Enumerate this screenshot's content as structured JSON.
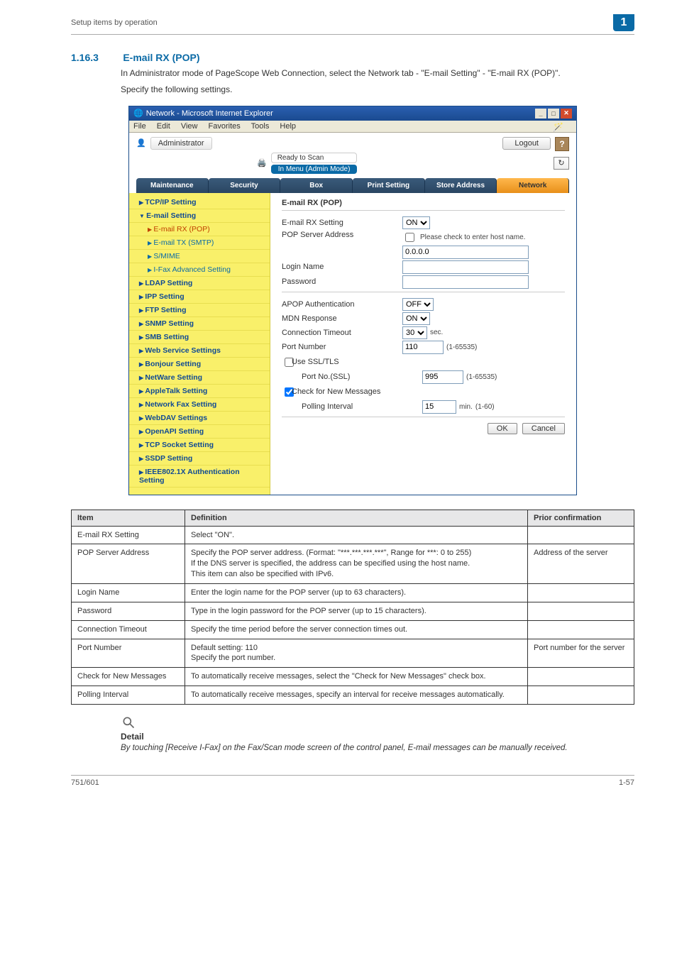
{
  "page": {
    "breadcrumb": "Setup items by operation",
    "chapter_badge": "1",
    "section_number": "1.16.3",
    "section_title": "E-mail RX (POP)",
    "intro_1": "In Administrator mode of PageScope Web Connection, select the Network tab - \"E-mail Setting\" - \"E-mail RX (POP)\".",
    "intro_2": "Specify the following settings.",
    "footer_left": "751/601",
    "footer_right": "1-57"
  },
  "browser": {
    "title": "Network - Microsoft Internet Explorer",
    "menu": {
      "file": "File",
      "edit": "Edit",
      "view": "View",
      "favorites": "Favorites",
      "tools": "Tools",
      "help": "Help"
    },
    "admin_icon_name": "user-icon",
    "admin_label": "Administrator",
    "logout": "Logout",
    "help_q": "?",
    "ready": "Ready to Scan",
    "mode": "In Menu (Admin Mode)",
    "refresh_glyph": "↻",
    "tabs": {
      "maintenance": "Maintenance",
      "security": "Security",
      "box": "Box",
      "print": "Print Setting",
      "store": "Store Address",
      "network": "Network"
    }
  },
  "sidebar": {
    "items": [
      {
        "label": "TCP/IP Setting",
        "type": "group",
        "arrow": "▶"
      },
      {
        "label": "E-mail Setting",
        "type": "group open",
        "arrow": "▼"
      },
      {
        "label": "E-mail RX (POP)",
        "type": "sub selected",
        "arrow": "▶"
      },
      {
        "label": "E-mail TX (SMTP)",
        "type": "sub",
        "arrow": "▶"
      },
      {
        "label": "S/MIME",
        "type": "sub",
        "arrow": "▶"
      },
      {
        "label": "I-Fax Advanced Setting",
        "type": "sub",
        "arrow": "▶"
      },
      {
        "label": "LDAP Setting",
        "type": "group",
        "arrow": "▶"
      },
      {
        "label": "IPP Setting",
        "type": "group",
        "arrow": "▶"
      },
      {
        "label": "FTP Setting",
        "type": "group",
        "arrow": "▶"
      },
      {
        "label": "SNMP Setting",
        "type": "group",
        "arrow": "▶"
      },
      {
        "label": "SMB Setting",
        "type": "group",
        "arrow": "▶"
      },
      {
        "label": "Web Service Settings",
        "type": "group",
        "arrow": "▶"
      },
      {
        "label": "Bonjour Setting",
        "type": "group",
        "arrow": "▶"
      },
      {
        "label": "NetWare Setting",
        "type": "group",
        "arrow": "▶"
      },
      {
        "label": "AppleTalk Setting",
        "type": "group",
        "arrow": "▶"
      },
      {
        "label": "Network Fax Setting",
        "type": "group",
        "arrow": "▶"
      },
      {
        "label": "WebDAV Settings",
        "type": "group",
        "arrow": "▶"
      },
      {
        "label": "OpenAPI Setting",
        "type": "group",
        "arrow": "▶"
      },
      {
        "label": "TCP Socket Setting",
        "type": "group",
        "arrow": "▶"
      },
      {
        "label": "SSDP Setting",
        "type": "group",
        "arrow": "▶"
      },
      {
        "label": "IEEE802.1X Authentication Setting",
        "type": "group",
        "arrow": "▶"
      }
    ]
  },
  "form": {
    "heading": "E-mail RX (POP)",
    "rows": {
      "rx_setting": {
        "label": "E-mail RX Setting",
        "value": "ON"
      },
      "pop_addr": {
        "label": "POP Server Address",
        "checkbox": "Please check to enter host name.",
        "value": "0.0.0.0"
      },
      "login": {
        "label": "Login Name",
        "value": ""
      },
      "pwd": {
        "label": "Password",
        "value": ""
      },
      "apop": {
        "label": "APOP Authentication",
        "value": "OFF"
      },
      "mdn": {
        "label": "MDN Response",
        "value": "ON"
      },
      "conn": {
        "label": "Connection Timeout",
        "value": "30",
        "unit": "sec."
      },
      "port": {
        "label": "Port Number",
        "value": "110",
        "hint": "(1-65535)"
      },
      "ssl": {
        "label": "Use SSL/TLS"
      },
      "sslport": {
        "label": "Port No.(SSL)",
        "value": "995",
        "hint": "(1-65535)"
      },
      "newmsg": {
        "label": "Check for New Messages"
      },
      "poll": {
        "label": "Polling Interval",
        "value": "15",
        "unit": "min.",
        "hint": "(1-60)"
      }
    },
    "ok": "OK",
    "cancel": "Cancel"
  },
  "table": {
    "head": {
      "item": "Item",
      "def": "Definition",
      "prior": "Prior confirmation"
    },
    "rows": [
      {
        "item": "E-mail RX Setting",
        "def": "Select \"ON\".",
        "prior": ""
      },
      {
        "item": "POP Server Address",
        "def": "Specify the POP server address. (Format: \"***.***.***.***\", Range for ***: 0 to 255)\nIf the DNS server is specified, the address can be specified using the host name.\nThis item can also be specified with IPv6.",
        "prior": "Address of the server"
      },
      {
        "item": "Login Name",
        "def": "Enter the login name for the POP server (up to 63 characters).",
        "prior": ""
      },
      {
        "item": "Password",
        "def": "Type in the login password for the POP server (up to 15 characters).",
        "prior": ""
      },
      {
        "item": "Connection Timeout",
        "def": "Specify the time period before the server connection times out.",
        "prior": ""
      },
      {
        "item": "Port Number",
        "def": "Default setting: 110\nSpecify the port number.",
        "prior": "Port number for the server"
      },
      {
        "item": "Check for New Messages",
        "def": "To automatically receive messages, select the \"Check for New Messages\" check box.",
        "prior": ""
      },
      {
        "item": "Polling Interval",
        "def": "To automatically receive messages, specify an interval for receive messages automatically.",
        "prior": ""
      }
    ]
  },
  "detail": {
    "label": "Detail",
    "text": "By touching [Receive I-Fax] on the Fax/Scan mode screen of the control panel, E-mail messages can be manually received."
  }
}
